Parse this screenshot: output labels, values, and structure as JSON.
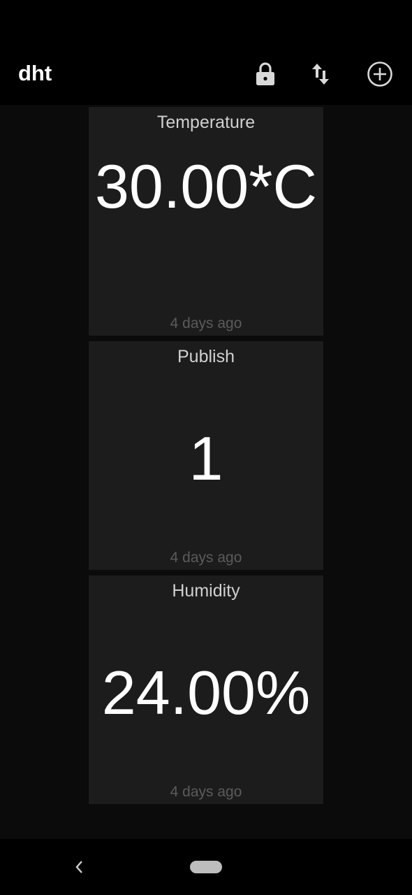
{
  "app": {
    "title": "dht"
  },
  "toolbar": {
    "actions": [
      {
        "icon": "lock-icon"
      },
      {
        "icon": "swap-vertical-icon"
      },
      {
        "icon": "add-circle-icon"
      }
    ]
  },
  "tiles": [
    {
      "title": "Temperature",
      "value": "30.00*C",
      "time": "4 days ago"
    },
    {
      "title": "Publish",
      "value": "1",
      "time": "4 days ago"
    },
    {
      "title": "Humidity",
      "value": "24.00%",
      "time": "4 days ago"
    }
  ],
  "colors": {
    "background": "#0b0b0b",
    "tile": "#1c1c1c",
    "bar": "#000000",
    "muted_text": "#5b5b5b"
  }
}
